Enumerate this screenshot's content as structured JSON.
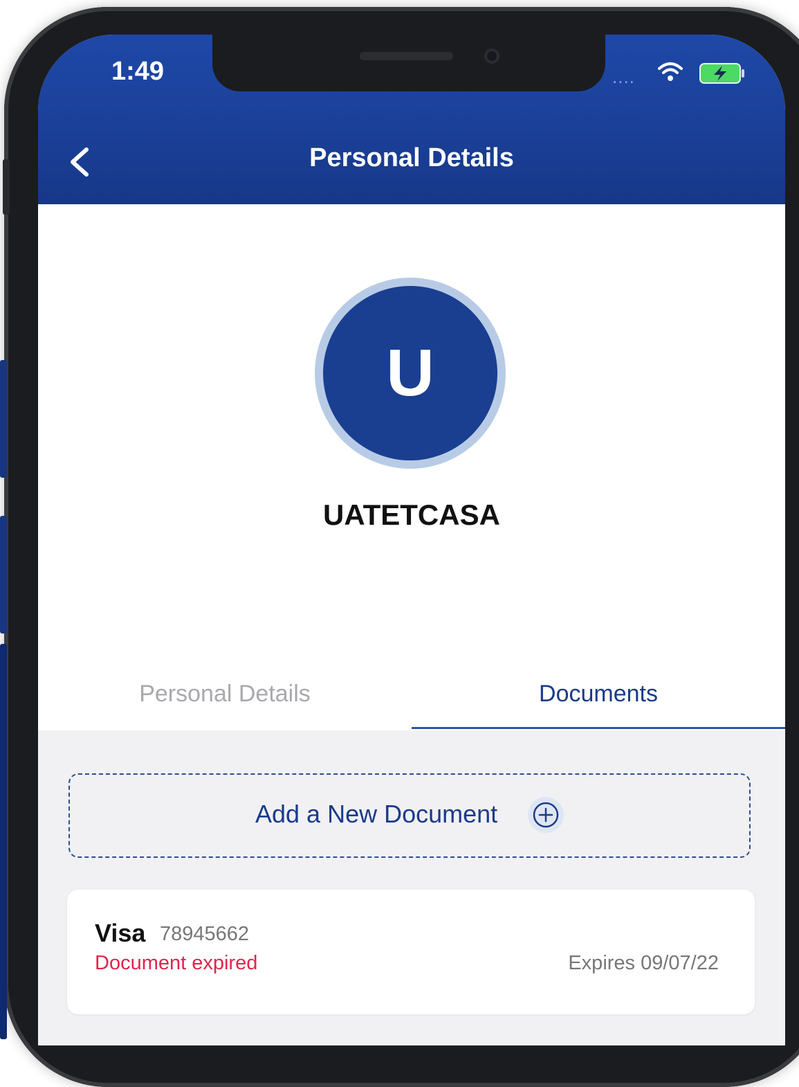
{
  "status_bar": {
    "time": "1:49",
    "signal": "....",
    "wifi_icon": "wifi-icon",
    "battery_icon": "battery-charging-icon",
    "battery_color": "#4cd964"
  },
  "header": {
    "title": "Personal Details",
    "back_icon": "chevron-left-icon",
    "background": "#1e48a8"
  },
  "profile": {
    "initial": "U",
    "name": "UATETCASA",
    "avatar_color": "#1a3f91"
  },
  "tabs": [
    {
      "label": "Personal Details",
      "active": false
    },
    {
      "label": "Documents",
      "active": true
    }
  ],
  "add_document": {
    "label": "Add a New Document",
    "icon": "plus-circle-icon"
  },
  "documents": [
    {
      "type": "Visa",
      "number": "78945662",
      "status": "Document expired",
      "expiry": "Expires 09/07/22",
      "status_color": "#e0254a"
    }
  ]
}
